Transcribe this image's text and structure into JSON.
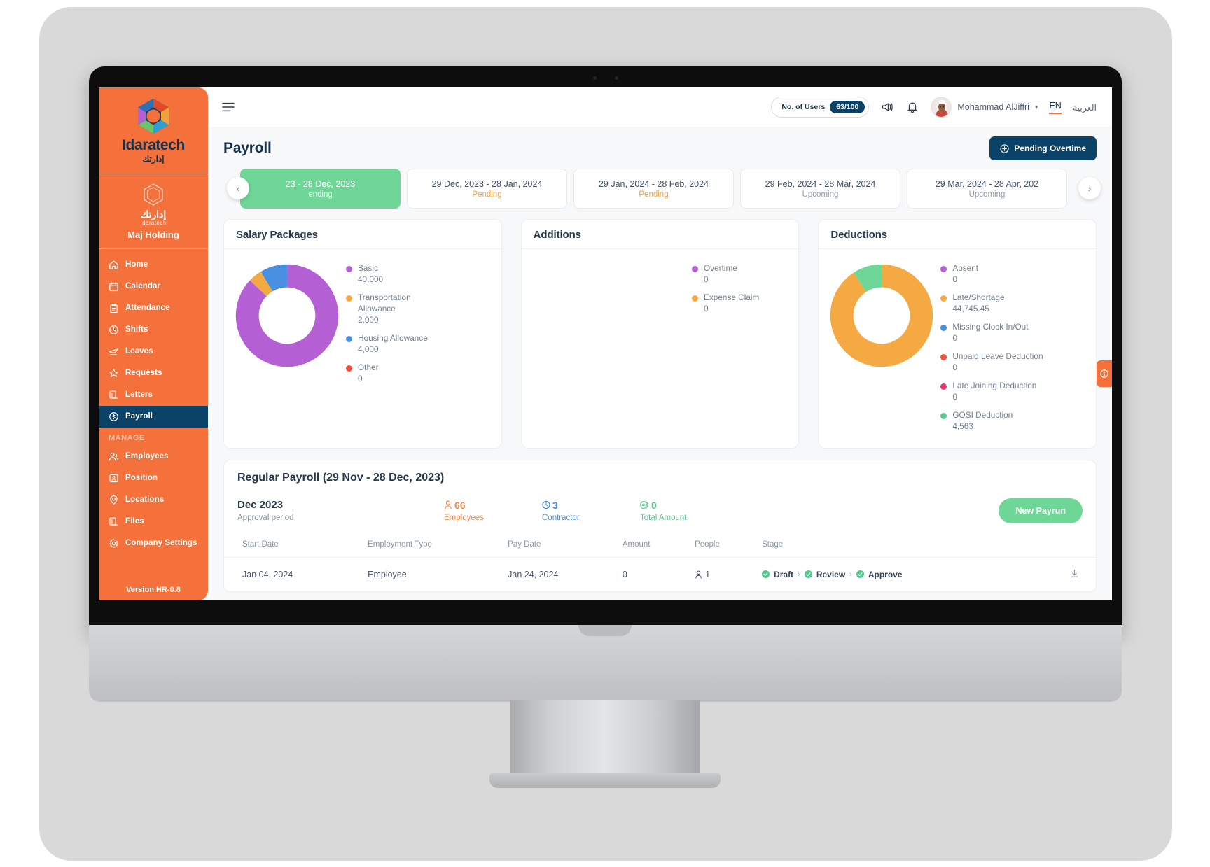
{
  "sidebar": {
    "brand": {
      "name": "Idaratech",
      "arabic": "إدارتك"
    },
    "org": {
      "arabic": "إدارتك",
      "latin": "Idaratech",
      "name": "Maj Holding"
    },
    "items": [
      {
        "label": "Home",
        "icon": "home-icon",
        "active": false
      },
      {
        "label": "Calendar",
        "icon": "calendar-icon",
        "active": false
      },
      {
        "label": "Attendance",
        "icon": "clipboard-icon",
        "active": false
      },
      {
        "label": "Shifts",
        "icon": "clock-icon",
        "active": false
      },
      {
        "label": "Leaves",
        "icon": "plane-icon",
        "active": false
      },
      {
        "label": "Requests",
        "icon": "star-icon",
        "active": false
      },
      {
        "label": "Letters",
        "icon": "documents-icon",
        "active": false
      },
      {
        "label": "Payroll",
        "icon": "coin-icon",
        "active": true
      }
    ],
    "section_label": "MANAGE",
    "manage_items": [
      {
        "label": "Employees",
        "icon": "people-icon"
      },
      {
        "label": "Position",
        "icon": "id-card-icon"
      },
      {
        "label": "Locations",
        "icon": "map-pin-icon"
      },
      {
        "label": "Files",
        "icon": "documents-icon"
      },
      {
        "label": "Company Settings",
        "icon": "gear-icon"
      }
    ],
    "version": "Version HR-0.8"
  },
  "topbar": {
    "users_label": "No. of Users",
    "users_count": "63/100",
    "user_name": "Mohammad AlJiffri",
    "lang_en": "EN",
    "lang_ar": "العربية"
  },
  "page": {
    "title": "Payroll",
    "overtime_button": "Pending Overtime"
  },
  "periods": [
    {
      "range": "23 - 28 Dec, 2023",
      "status": "ending",
      "state": "current"
    },
    {
      "range": "29 Dec, 2023 - 28 Jan, 2024",
      "status": "Pending",
      "state": "pending"
    },
    {
      "range": "29 Jan, 2024 - 28 Feb, 2024",
      "status": "Pending",
      "state": "pending"
    },
    {
      "range": "29 Feb, 2024 - 28 Mar, 2024",
      "status": "Upcoming",
      "state": "upcoming"
    },
    {
      "range": "29 Mar, 2024 - 28 Apr, 202",
      "status": "Upcoming",
      "state": "upcoming"
    }
  ],
  "chart_data": [
    {
      "type": "pie",
      "title": "Salary Packages",
      "categories": [
        "Basic",
        "Transportation Allowance",
        "Housing Allowance",
        "Other"
      ],
      "values": [
        40000,
        2000,
        4000,
        0
      ],
      "value_labels": [
        "40,000",
        "2,000",
        "4,000",
        "0"
      ],
      "colors": [
        "#b55fd4",
        "#f5a942",
        "#4a90e2",
        "#f74c3c"
      ],
      "legend_position": "right",
      "donut": true
    },
    {
      "type": "pie",
      "title": "Additions",
      "categories": [
        "Overtime",
        "Expense Claim"
      ],
      "values": [
        0,
        0
      ],
      "value_labels": [
        "0",
        "0"
      ],
      "colors": [
        "#b55fd4",
        "#f5a942"
      ],
      "legend_position": "right",
      "donut": true
    },
    {
      "type": "pie",
      "title": "Deductions",
      "categories": [
        "Absent",
        "Late/Shortage",
        "Missing Clock In/Out",
        "Unpaid Leave Deduction",
        "Late Joining Deduction",
        "GOSI Deduction"
      ],
      "values": [
        0,
        44745.45,
        0,
        0,
        0,
        4563
      ],
      "value_labels": [
        "0",
        "44,745.45",
        "0",
        "0",
        "0",
        "4,563"
      ],
      "colors": [
        "#b55fd4",
        "#f5a942",
        "#4a90e2",
        "#f74c3c",
        "#e8326e",
        "#56c98a"
      ],
      "legend_position": "right",
      "donut": true
    }
  ],
  "payroll": {
    "header": "Regular Payroll (29 Nov - 28 Dec, 2023)",
    "period_title": "Dec 2023",
    "period_sub": "Approval period",
    "stats": [
      {
        "value": "66",
        "label": "Employees",
        "icon": "person-icon"
      },
      {
        "value": "3",
        "label": "Contractor",
        "icon": "clock-icon"
      },
      {
        "value": "0",
        "label": "Total Amount",
        "icon": "money-icon"
      }
    ],
    "new_payrun_button": "New Payrun",
    "columns": [
      "Start Date",
      "Employment Type",
      "Pay Date",
      "Amount",
      "People",
      "Stage"
    ],
    "rows": [
      {
        "start_date": "Jan 04, 2024",
        "employment_type": "Employee",
        "pay_date": "Jan 24, 2024",
        "amount": "0",
        "people": "1",
        "stages": [
          "Draft",
          "Review",
          "Approve"
        ]
      }
    ]
  }
}
